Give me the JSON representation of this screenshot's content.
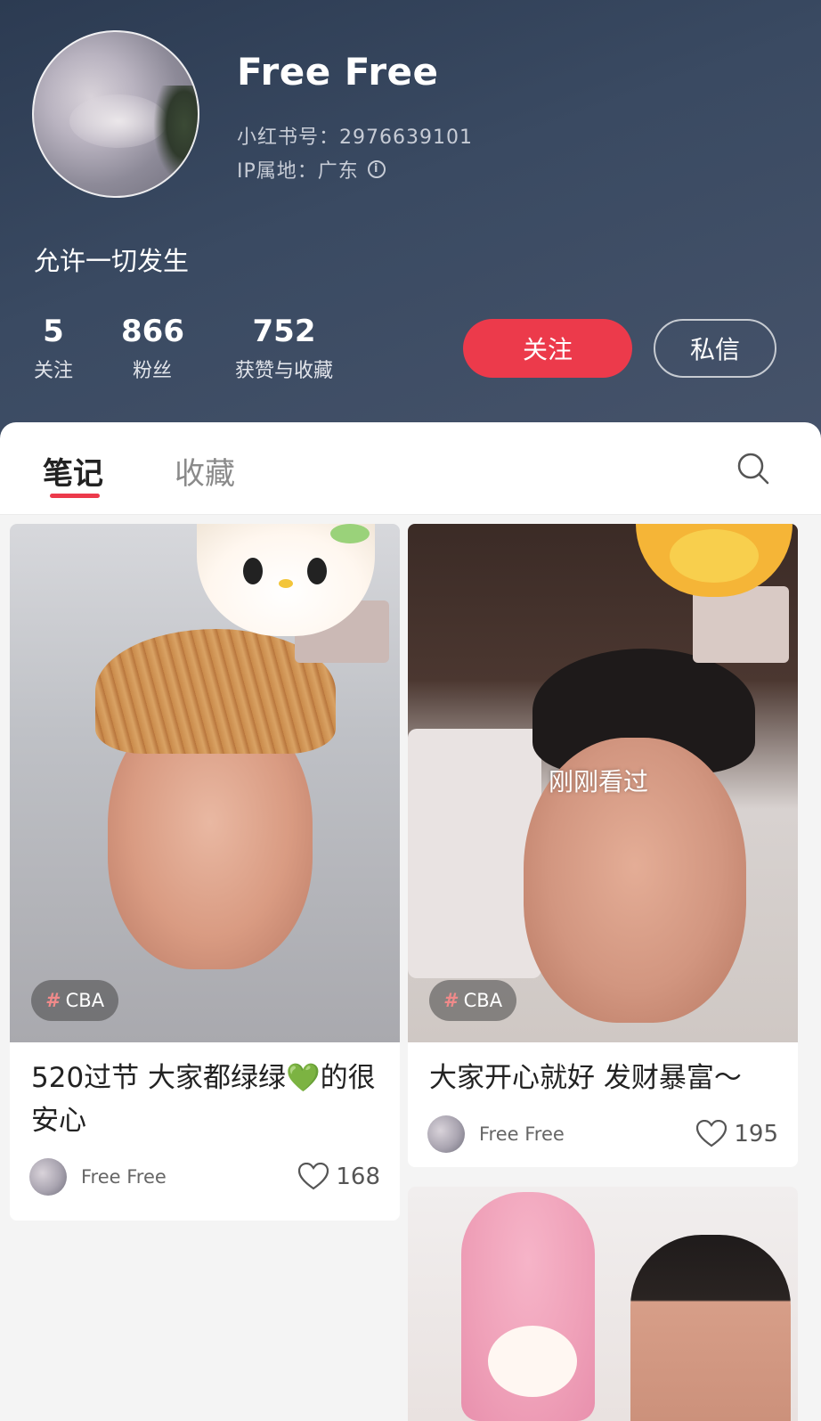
{
  "profile": {
    "name": "Free Free",
    "id_text": "小红书号：2976639101",
    "ip_text": "IP属地：广东",
    "bio": "允许一切发生",
    "stats": [
      {
        "value": "5",
        "label": "关注"
      },
      {
        "value": "866",
        "label": "粉丝"
      },
      {
        "value": "752",
        "label": "获赞与收藏"
      }
    ],
    "follow_label": "关注",
    "message_label": "私信"
  },
  "tabs": [
    {
      "label": "笔记",
      "active": true
    },
    {
      "label": "收藏",
      "active": false
    }
  ],
  "icons": {
    "search": "search-icon",
    "info": "info-icon",
    "like": "heart-icon"
  },
  "colors": {
    "accent": "#ec3a4b",
    "header_bg": "#2f3d54"
  },
  "notes": [
    {
      "title": "520过节 大家都绿绿💚的很安心",
      "topic": "CBA",
      "author": "Free Free",
      "likes": "168"
    },
    {
      "title": "大家开心就好 发财暴富～",
      "topic": "CBA",
      "overlay": "刚刚看过",
      "author": "Free Free",
      "likes": "195"
    }
  ]
}
